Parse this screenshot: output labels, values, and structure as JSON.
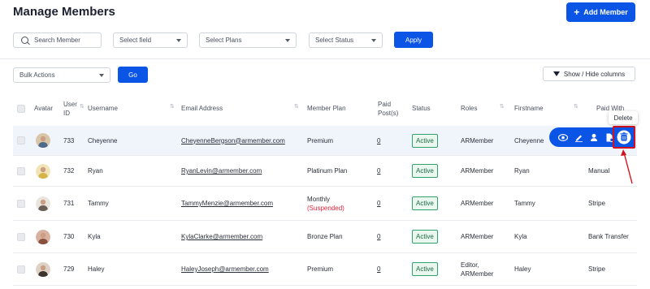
{
  "page_title": "Manage Members",
  "add_member_label": "Add Member",
  "filters": {
    "search_placeholder": "Search Member",
    "field_select": "Select field",
    "plans_select": "Select Plans",
    "status_select": "Select Status",
    "apply_label": "Apply"
  },
  "bulk": {
    "select": "Bulk Actions",
    "go_label": "Go"
  },
  "show_hide_label": "Show / Hide columns",
  "columns": {
    "avatar": "Avatar",
    "user_id_1": "User",
    "user_id_2": "ID",
    "username": "Username",
    "email": "Email Address",
    "plan": "Member Plan",
    "paid_1": "Paid",
    "paid_2": "Post(s)",
    "status": "Status",
    "roles": "Roles",
    "firstname": "Firstname",
    "paid_with": "Paid With"
  },
  "rows": [
    {
      "id": "733",
      "username": "Cheyenne",
      "email": "CheyenneBergson@armember.com",
      "plan": "Premium",
      "plan_note": "",
      "paid": "0",
      "status": "Active",
      "roles": "ARMember",
      "roles2": "",
      "firstname": "Cheyenne",
      "paid_with": ""
    },
    {
      "id": "732",
      "username": "Ryan",
      "email": "RyanLevin@armember.com",
      "plan": "Platinum Plan",
      "plan_note": "",
      "paid": "0",
      "status": "Active",
      "roles": "ARMember",
      "roles2": "",
      "firstname": "Ryan",
      "paid_with": "Manual"
    },
    {
      "id": "731",
      "username": "Tammy",
      "email": "TammyMenzie@armember.com",
      "plan": "Monthly",
      "plan_note": "(Suspended)",
      "paid": "0",
      "status": "Active",
      "roles": "ARMember",
      "roles2": "",
      "firstname": "Tammy",
      "paid_with": "Stripe"
    },
    {
      "id": "730",
      "username": "Kyla",
      "email": "KylaClarke@armember.com",
      "plan": "Bronze Plan",
      "plan_note": "",
      "paid": "0",
      "status": "Active",
      "roles": "ARMember",
      "roles2": "",
      "firstname": "Kyla",
      "paid_with": "Bank Transfer"
    },
    {
      "id": "729",
      "username": "Haley",
      "email": "HaleyJoseph@armember.com",
      "plan": "Premium",
      "plan_note": "",
      "paid": "0",
      "status": "Active",
      "roles": "Editor,",
      "roles2": "ARMember",
      "firstname": "Haley",
      "paid_with": "Stripe"
    }
  ],
  "row_actions": {
    "icons": [
      "eye-icon",
      "edit-icon",
      "user-icon",
      "file-icon",
      "trash-icon"
    ],
    "tooltip": "Delete"
  },
  "colors": {
    "primary": "#0a55e6",
    "highlight": "#d4121f",
    "active_green": "#2fa36b",
    "suspended": "#e0243c"
  }
}
